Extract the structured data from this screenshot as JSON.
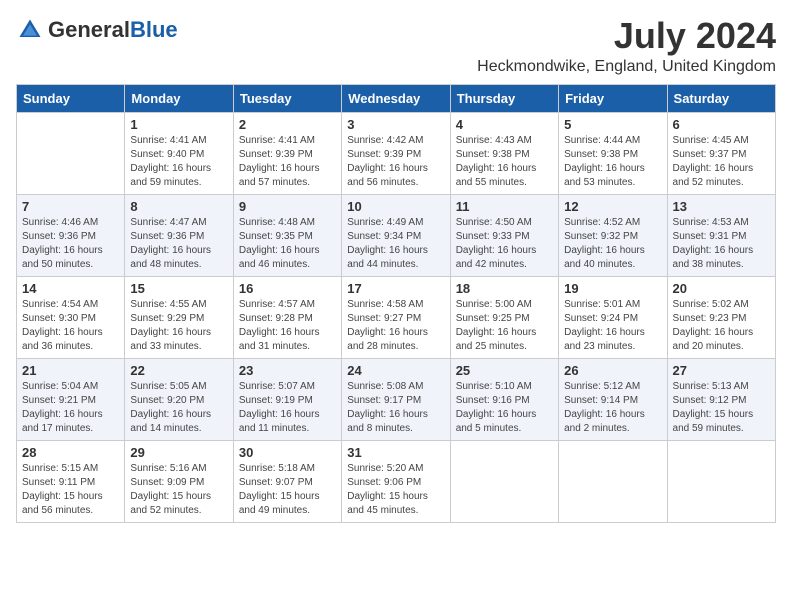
{
  "header": {
    "logo_general": "General",
    "logo_blue": "Blue",
    "month_title": "July 2024",
    "location": "Heckmondwike, England, United Kingdom"
  },
  "days_of_week": [
    "Sunday",
    "Monday",
    "Tuesday",
    "Wednesday",
    "Thursday",
    "Friday",
    "Saturday"
  ],
  "weeks": [
    [
      {
        "day": "",
        "info": ""
      },
      {
        "day": "1",
        "info": "Sunrise: 4:41 AM\nSunset: 9:40 PM\nDaylight: 16 hours\nand 59 minutes."
      },
      {
        "day": "2",
        "info": "Sunrise: 4:41 AM\nSunset: 9:39 PM\nDaylight: 16 hours\nand 57 minutes."
      },
      {
        "day": "3",
        "info": "Sunrise: 4:42 AM\nSunset: 9:39 PM\nDaylight: 16 hours\nand 56 minutes."
      },
      {
        "day": "4",
        "info": "Sunrise: 4:43 AM\nSunset: 9:38 PM\nDaylight: 16 hours\nand 55 minutes."
      },
      {
        "day": "5",
        "info": "Sunrise: 4:44 AM\nSunset: 9:38 PM\nDaylight: 16 hours\nand 53 minutes."
      },
      {
        "day": "6",
        "info": "Sunrise: 4:45 AM\nSunset: 9:37 PM\nDaylight: 16 hours\nand 52 minutes."
      }
    ],
    [
      {
        "day": "7",
        "info": "Sunrise: 4:46 AM\nSunset: 9:36 PM\nDaylight: 16 hours\nand 50 minutes."
      },
      {
        "day": "8",
        "info": "Sunrise: 4:47 AM\nSunset: 9:36 PM\nDaylight: 16 hours\nand 48 minutes."
      },
      {
        "day": "9",
        "info": "Sunrise: 4:48 AM\nSunset: 9:35 PM\nDaylight: 16 hours\nand 46 minutes."
      },
      {
        "day": "10",
        "info": "Sunrise: 4:49 AM\nSunset: 9:34 PM\nDaylight: 16 hours\nand 44 minutes."
      },
      {
        "day": "11",
        "info": "Sunrise: 4:50 AM\nSunset: 9:33 PM\nDaylight: 16 hours\nand 42 minutes."
      },
      {
        "day": "12",
        "info": "Sunrise: 4:52 AM\nSunset: 9:32 PM\nDaylight: 16 hours\nand 40 minutes."
      },
      {
        "day": "13",
        "info": "Sunrise: 4:53 AM\nSunset: 9:31 PM\nDaylight: 16 hours\nand 38 minutes."
      }
    ],
    [
      {
        "day": "14",
        "info": "Sunrise: 4:54 AM\nSunset: 9:30 PM\nDaylight: 16 hours\nand 36 minutes."
      },
      {
        "day": "15",
        "info": "Sunrise: 4:55 AM\nSunset: 9:29 PM\nDaylight: 16 hours\nand 33 minutes."
      },
      {
        "day": "16",
        "info": "Sunrise: 4:57 AM\nSunset: 9:28 PM\nDaylight: 16 hours\nand 31 minutes."
      },
      {
        "day": "17",
        "info": "Sunrise: 4:58 AM\nSunset: 9:27 PM\nDaylight: 16 hours\nand 28 minutes."
      },
      {
        "day": "18",
        "info": "Sunrise: 5:00 AM\nSunset: 9:25 PM\nDaylight: 16 hours\nand 25 minutes."
      },
      {
        "day": "19",
        "info": "Sunrise: 5:01 AM\nSunset: 9:24 PM\nDaylight: 16 hours\nand 23 minutes."
      },
      {
        "day": "20",
        "info": "Sunrise: 5:02 AM\nSunset: 9:23 PM\nDaylight: 16 hours\nand 20 minutes."
      }
    ],
    [
      {
        "day": "21",
        "info": "Sunrise: 5:04 AM\nSunset: 9:21 PM\nDaylight: 16 hours\nand 17 minutes."
      },
      {
        "day": "22",
        "info": "Sunrise: 5:05 AM\nSunset: 9:20 PM\nDaylight: 16 hours\nand 14 minutes."
      },
      {
        "day": "23",
        "info": "Sunrise: 5:07 AM\nSunset: 9:19 PM\nDaylight: 16 hours\nand 11 minutes."
      },
      {
        "day": "24",
        "info": "Sunrise: 5:08 AM\nSunset: 9:17 PM\nDaylight: 16 hours\nand 8 minutes."
      },
      {
        "day": "25",
        "info": "Sunrise: 5:10 AM\nSunset: 9:16 PM\nDaylight: 16 hours\nand 5 minutes."
      },
      {
        "day": "26",
        "info": "Sunrise: 5:12 AM\nSunset: 9:14 PM\nDaylight: 16 hours\nand 2 minutes."
      },
      {
        "day": "27",
        "info": "Sunrise: 5:13 AM\nSunset: 9:12 PM\nDaylight: 15 hours\nand 59 minutes."
      }
    ],
    [
      {
        "day": "28",
        "info": "Sunrise: 5:15 AM\nSunset: 9:11 PM\nDaylight: 15 hours\nand 56 minutes."
      },
      {
        "day": "29",
        "info": "Sunrise: 5:16 AM\nSunset: 9:09 PM\nDaylight: 15 hours\nand 52 minutes."
      },
      {
        "day": "30",
        "info": "Sunrise: 5:18 AM\nSunset: 9:07 PM\nDaylight: 15 hours\nand 49 minutes."
      },
      {
        "day": "31",
        "info": "Sunrise: 5:20 AM\nSunset: 9:06 PM\nDaylight: 15 hours\nand 45 minutes."
      },
      {
        "day": "",
        "info": ""
      },
      {
        "day": "",
        "info": ""
      },
      {
        "day": "",
        "info": ""
      }
    ]
  ]
}
